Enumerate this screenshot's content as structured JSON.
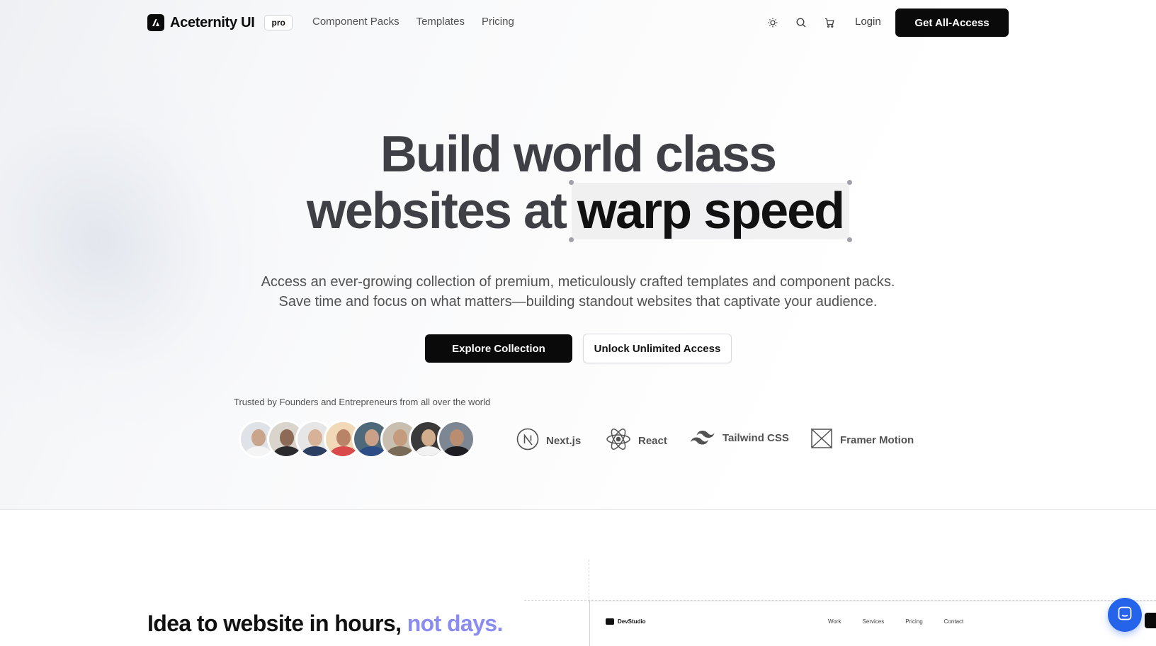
{
  "nav": {
    "brand": "Aceternity UI",
    "badge": "pro",
    "links": [
      "Component Packs",
      "Templates",
      "Pricing"
    ],
    "icons": [
      "sun-icon",
      "search-icon",
      "cart-icon"
    ],
    "login": "Login",
    "cta": "Get All-Access"
  },
  "hero": {
    "headline_line1": "Build world class",
    "headline_line2_prefix": "websites at",
    "headline_highlight": "warp speed",
    "subtitle_line1": "Access an ever-growing collection of premium, meticulously crafted templates and component packs.",
    "subtitle_line2": "Save time and focus on what matters—building standout websites that captivate your audience.",
    "primary_button": "Explore Collection",
    "secondary_button": "Unlock Unlimited Access",
    "trusted_text": "Trusted by Founders and Entrepreneurs from all over the world",
    "avatar_count": 8,
    "tech_stack": [
      "Next.js",
      "React",
      "Tailwind CSS",
      "Framer Motion"
    ]
  },
  "section": {
    "title": "Idea to website in hours,",
    "title_accent": "not days."
  },
  "preview": {
    "brand": "DevStudio",
    "links": [
      "Work",
      "Services",
      "Pricing",
      "Contact"
    ]
  },
  "colors": {
    "primary": "#0a0a0a",
    "accent": "#8b8cf2",
    "chat": "#2563eb"
  }
}
